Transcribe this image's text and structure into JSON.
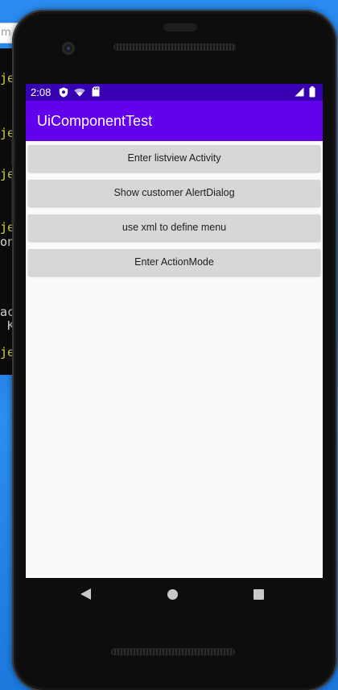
{
  "desktop": {
    "input_fragment": "m",
    "code_lines": [
      {
        "text": "je",
        "color": "#d8d44a"
      },
      {
        "text": "je",
        "color": "#d8d44a"
      },
      {
        "text": "je",
        "color": "#d8d44a"
      },
      {
        "text": "je",
        "color": "#d8d44a"
      },
      {
        "text": "on",
        "color": "#d6d6d6"
      },
      {
        "text": "ac",
        "color": "#d6d6d6"
      },
      {
        "text": " K",
        "color": "#d6d6d6"
      },
      {
        "text": "je",
        "color": "#d8d44a"
      }
    ]
  },
  "status_bar": {
    "time": "2:08",
    "left_icons": [
      "shield-icon",
      "wifi-off-icon",
      "sd-card-icon"
    ],
    "right_icons": [
      "cell-signal-icon",
      "battery-icon"
    ],
    "color": "#3700b3"
  },
  "app_bar": {
    "title": "UiComponentTest",
    "color": "#6200ee"
  },
  "buttons": [
    {
      "label": "Enter listview Activity"
    },
    {
      "label": "Show customer AlertDialog"
    },
    {
      "label": "use xml to define menu"
    },
    {
      "label": "Enter ActionMode"
    }
  ],
  "nav_bar": {
    "icons": [
      "back-icon",
      "home-icon",
      "recents-icon"
    ]
  }
}
